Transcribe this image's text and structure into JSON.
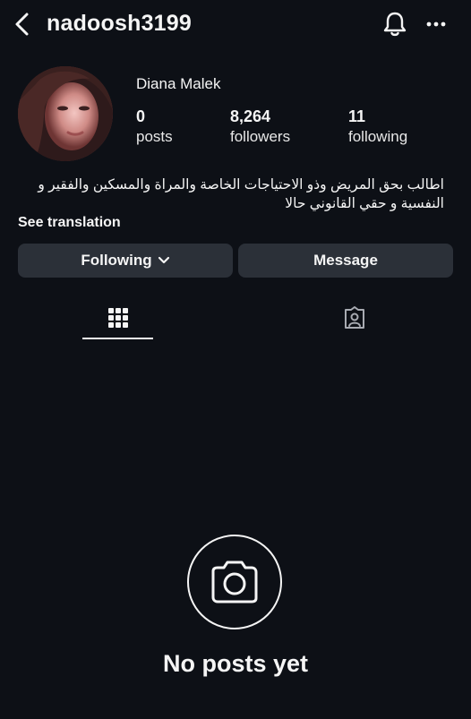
{
  "header": {
    "username": "nadoosh3199",
    "back_icon": "chevron-left-icon",
    "bell_icon": "bell-icon",
    "more_icon": "more-horizontal-icon"
  },
  "profile": {
    "display_name": "Diana Malek",
    "stats": {
      "posts": {
        "value": "0",
        "label": "posts"
      },
      "followers": {
        "value": "8,264",
        "label": "followers"
      },
      "following": {
        "value": "11",
        "label": "following"
      }
    },
    "bio_line1": "اطالب بحق المريض وذو الاحتياجات الخاصة والمراة والمسكين والفقير و",
    "bio_line2": "النفسية و حقي القانوني حالا",
    "see_translation": "See translation"
  },
  "actions": {
    "following_label": "Following",
    "message_label": "Message"
  },
  "tabs": {
    "grid_icon": "grid-icon",
    "tagged_icon": "tagged-person-icon"
  },
  "empty_state": {
    "icon": "camera-icon",
    "title": "No posts yet"
  },
  "colors": {
    "background": "#0d1016",
    "button": "#2b3038",
    "text": "#f5f5f5"
  }
}
